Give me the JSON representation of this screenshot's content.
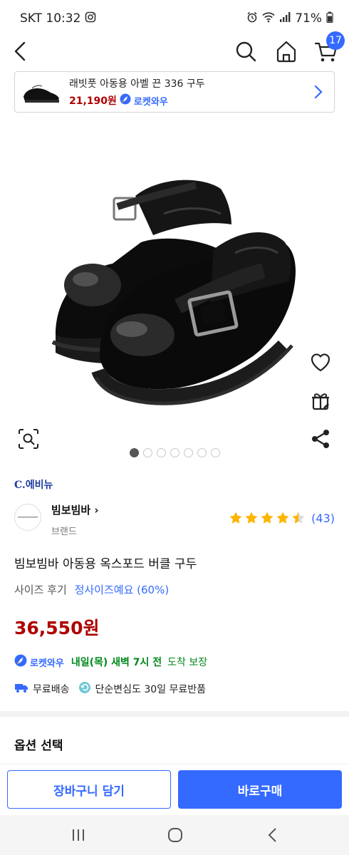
{
  "status_bar": {
    "carrier_time": "SKT 10:32",
    "battery": "71%"
  },
  "nav": {
    "cart_count": "17"
  },
  "related": {
    "title": "래빗풋 아동용 아벨 끈 336 구두",
    "price": "21,190원",
    "rocket_label": "로켓와우"
  },
  "gallery": {
    "image_count": 7,
    "active_index": 0
  },
  "shop": {
    "logo_text": "C.에비뉴"
  },
  "brand": {
    "name": "빔보빔바",
    "sub_label": "브랜드",
    "rating": 4.5,
    "review_count": "(43)"
  },
  "product": {
    "title": "빔보빔바 아동용 옥스포드 버클 구두",
    "size_label": "사이즈 후기",
    "size_value": "정사이즈예요 (60%)",
    "price": "36,550원"
  },
  "delivery": {
    "rocket_label": "로켓와우",
    "date_text": "내일(목) 새벽 7시 전",
    "guarantee_text": "도착 보장"
  },
  "benefits": {
    "free_shipping": "무료배송",
    "free_return": "단순변심도 30일 무료반품"
  },
  "options": {
    "label": "옵션 선택"
  },
  "actions": {
    "cart_label": "장바구니 담기",
    "buy_label": "바로구매"
  },
  "colors": {
    "accent": "#346aff",
    "price_red": "#ae0000",
    "delivery_green": "#00891a"
  }
}
